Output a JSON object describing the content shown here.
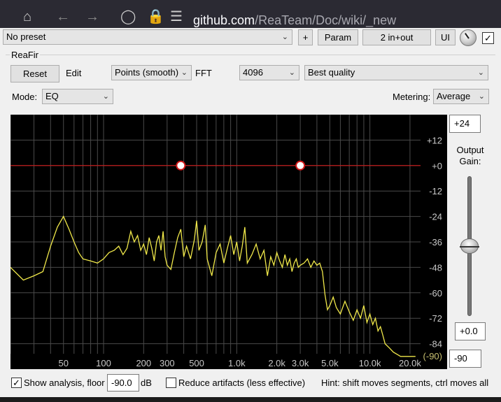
{
  "browser": {
    "url_host": "github.com",
    "url_path": "/ReaTeam/Doc/wiki/_new"
  },
  "topbar": {
    "preset": "No preset",
    "plus_label": "+",
    "param_label": "Param",
    "io_label": "2 in+out",
    "ui_label": "UI",
    "bypass_checked": true
  },
  "plugin": {
    "name": "ReaFir",
    "reset_label": "Reset",
    "edit_label": "Edit",
    "edit_mode": "Points (smooth)",
    "fft_label": "FFT",
    "fft_size": "4096",
    "quality": "Best quality",
    "mode_label": "Mode:",
    "mode": "EQ",
    "metering_label": "Metering:",
    "metering": "Average"
  },
  "gain": {
    "top_value": "+24",
    "label": "Output Gain:",
    "gain_value": "+0.0",
    "floor_value": "-90",
    "slider_fraction": 0.5
  },
  "bottom": {
    "show_analysis_label": "Show analysis, floor",
    "show_analysis_checked": true,
    "floor_value": "-90.0",
    "db_unit": "dB",
    "reduce_label": "Reduce artifacts (less effective)",
    "reduce_checked": false,
    "hint": "Hint: shift moves segments, ctrl moves all"
  },
  "chart_data": {
    "type": "line",
    "x_scale": "log",
    "xlim": [
      20,
      24000
    ],
    "ylim": [
      -96,
      24
    ],
    "x_ticks": [
      {
        "value": 50,
        "label": "50"
      },
      {
        "value": 100,
        "label": "100"
      },
      {
        "value": 200,
        "label": "200"
      },
      {
        "value": 300,
        "label": "300"
      },
      {
        "value": 500,
        "label": "500"
      },
      {
        "value": 1000,
        "label": "1.0k"
      },
      {
        "value": 2000,
        "label": "2.0k"
      },
      {
        "value": 3000,
        "label": "3.0k"
      },
      {
        "value": 5000,
        "label": "5.0k"
      },
      {
        "value": 10000,
        "label": "10.0k"
      },
      {
        "value": 20000,
        "label": "20.0k"
      }
    ],
    "y_ticks": [
      {
        "value": 12,
        "label": "+12"
      },
      {
        "value": 0,
        "label": "+0"
      },
      {
        "value": -12,
        "label": "-12"
      },
      {
        "value": -24,
        "label": "-24"
      },
      {
        "value": -36,
        "label": "-36"
      },
      {
        "value": -48,
        "label": "-48"
      },
      {
        "value": -60,
        "label": "-60"
      },
      {
        "value": -72,
        "label": "-72"
      },
      {
        "value": -84,
        "label": "-84"
      }
    ],
    "floor_label": "(-90)",
    "grid": true,
    "eq_curve": {
      "color": "#d01818",
      "points": [
        {
          "x": 20,
          "y": 0
        },
        {
          "x": 380,
          "y": 0
        },
        {
          "x": 3000,
          "y": 0
        },
        {
          "x": 24000,
          "y": 0
        }
      ],
      "handles": [
        {
          "x": 380,
          "y": 0
        },
        {
          "x": 3000,
          "y": 0
        }
      ]
    },
    "analysis": {
      "color": "#f0e84a",
      "x": [
        20,
        25,
        30,
        35,
        40,
        45,
        50,
        55,
        60,
        65,
        70,
        80,
        90,
        100,
        110,
        120,
        130,
        140,
        150,
        160,
        170,
        180,
        190,
        200,
        210,
        220,
        230,
        240,
        250,
        260,
        270,
        280,
        290,
        300,
        320,
        340,
        360,
        380,
        400,
        420,
        450,
        480,
        500,
        520,
        550,
        580,
        600,
        650,
        700,
        750,
        800,
        850,
        900,
        950,
        1000,
        1050,
        1100,
        1150,
        1200,
        1300,
        1400,
        1500,
        1600,
        1700,
        1800,
        1900,
        2000,
        2100,
        2200,
        2300,
        2400,
        2500,
        2600,
        2700,
        2800,
        2900,
        3000,
        3200,
        3400,
        3600,
        3800,
        4000,
        4200,
        4400,
        4600,
        4800,
        5000,
        5300,
        5600,
        6000,
        6500,
        7000,
        7500,
        8000,
        8500,
        9000,
        9500,
        10000,
        10500,
        11000,
        11500,
        12000,
        12500,
        13000,
        14000,
        15000,
        16000,
        17000,
        18000,
        19000,
        20000,
        21000,
        22000,
        23000,
        24000
      ],
      "y": [
        -48,
        -54,
        -52,
        -50,
        -38,
        -29,
        -24,
        -30,
        -36,
        -41,
        -44,
        -45,
        -46,
        -44,
        -41,
        -40,
        -38,
        -42,
        -39,
        -31,
        -36,
        -33,
        -40,
        -37,
        -42,
        -34,
        -39,
        -45,
        -36,
        -33,
        -40,
        -31,
        -43,
        -47,
        -49,
        -41,
        -34,
        -30,
        -43,
        -38,
        -44,
        -35,
        -26,
        -40,
        -36,
        -28,
        -44,
        -52,
        -41,
        -37,
        -46,
        -39,
        -33,
        -42,
        -36,
        -45,
        -38,
        -29,
        -46,
        -42,
        -37,
        -44,
        -40,
        -52,
        -43,
        -47,
        -41,
        -45,
        -48,
        -42,
        -47,
        -44,
        -50,
        -46,
        -44,
        -48,
        -47,
        -46,
        -44,
        -48,
        -45,
        -47,
        -46,
        -50,
        -61,
        -68,
        -66,
        -62,
        -67,
        -70,
        -64,
        -69,
        -73,
        -68,
        -72,
        -66,
        -74,
        -70,
        -75,
        -72,
        -78,
        -76,
        -80,
        -84,
        -86,
        -88,
        -89,
        -90,
        -90,
        -90,
        -90,
        -90,
        -90
      ]
    }
  }
}
